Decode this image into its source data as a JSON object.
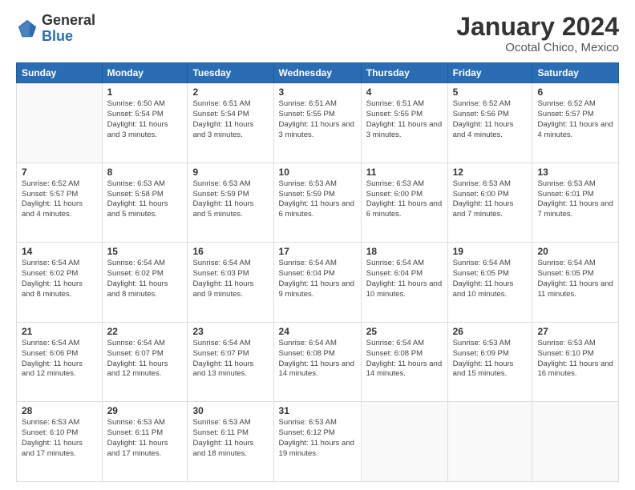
{
  "header": {
    "logo": {
      "general": "General",
      "blue": "Blue"
    },
    "title": "January 2024",
    "subtitle": "Ocotal Chico, Mexico"
  },
  "calendar": {
    "weekdays": [
      "Sunday",
      "Monday",
      "Tuesday",
      "Wednesday",
      "Thursday",
      "Friday",
      "Saturday"
    ],
    "weeks": [
      [
        {
          "day": "",
          "empty": true
        },
        {
          "day": "1",
          "sunrise": "6:50 AM",
          "sunset": "5:54 PM",
          "daylight": "11 hours and 3 minutes."
        },
        {
          "day": "2",
          "sunrise": "6:51 AM",
          "sunset": "5:54 PM",
          "daylight": "11 hours and 3 minutes."
        },
        {
          "day": "3",
          "sunrise": "6:51 AM",
          "sunset": "5:55 PM",
          "daylight": "11 hours and 3 minutes."
        },
        {
          "day": "4",
          "sunrise": "6:51 AM",
          "sunset": "5:55 PM",
          "daylight": "11 hours and 3 minutes."
        },
        {
          "day": "5",
          "sunrise": "6:52 AM",
          "sunset": "5:56 PM",
          "daylight": "11 hours and 4 minutes."
        },
        {
          "day": "6",
          "sunrise": "6:52 AM",
          "sunset": "5:57 PM",
          "daylight": "11 hours and 4 minutes."
        }
      ],
      [
        {
          "day": "7",
          "sunrise": "6:52 AM",
          "sunset": "5:57 PM",
          "daylight": "11 hours and 4 minutes."
        },
        {
          "day": "8",
          "sunrise": "6:53 AM",
          "sunset": "5:58 PM",
          "daylight": "11 hours and 5 minutes."
        },
        {
          "day": "9",
          "sunrise": "6:53 AM",
          "sunset": "5:59 PM",
          "daylight": "11 hours and 5 minutes."
        },
        {
          "day": "10",
          "sunrise": "6:53 AM",
          "sunset": "5:59 PM",
          "daylight": "11 hours and 6 minutes."
        },
        {
          "day": "11",
          "sunrise": "6:53 AM",
          "sunset": "6:00 PM",
          "daylight": "11 hours and 6 minutes."
        },
        {
          "day": "12",
          "sunrise": "6:53 AM",
          "sunset": "6:00 PM",
          "daylight": "11 hours and 7 minutes."
        },
        {
          "day": "13",
          "sunrise": "6:53 AM",
          "sunset": "6:01 PM",
          "daylight": "11 hours and 7 minutes."
        }
      ],
      [
        {
          "day": "14",
          "sunrise": "6:54 AM",
          "sunset": "6:02 PM",
          "daylight": "11 hours and 8 minutes."
        },
        {
          "day": "15",
          "sunrise": "6:54 AM",
          "sunset": "6:02 PM",
          "daylight": "11 hours and 8 minutes."
        },
        {
          "day": "16",
          "sunrise": "6:54 AM",
          "sunset": "6:03 PM",
          "daylight": "11 hours and 9 minutes."
        },
        {
          "day": "17",
          "sunrise": "6:54 AM",
          "sunset": "6:04 PM",
          "daylight": "11 hours and 9 minutes."
        },
        {
          "day": "18",
          "sunrise": "6:54 AM",
          "sunset": "6:04 PM",
          "daylight": "11 hours and 10 minutes."
        },
        {
          "day": "19",
          "sunrise": "6:54 AM",
          "sunset": "6:05 PM",
          "daylight": "11 hours and 10 minutes."
        },
        {
          "day": "20",
          "sunrise": "6:54 AM",
          "sunset": "6:05 PM",
          "daylight": "11 hours and 11 minutes."
        }
      ],
      [
        {
          "day": "21",
          "sunrise": "6:54 AM",
          "sunset": "6:06 PM",
          "daylight": "11 hours and 12 minutes."
        },
        {
          "day": "22",
          "sunrise": "6:54 AM",
          "sunset": "6:07 PM",
          "daylight": "11 hours and 12 minutes."
        },
        {
          "day": "23",
          "sunrise": "6:54 AM",
          "sunset": "6:07 PM",
          "daylight": "11 hours and 13 minutes."
        },
        {
          "day": "24",
          "sunrise": "6:54 AM",
          "sunset": "6:08 PM",
          "daylight": "11 hours and 14 minutes."
        },
        {
          "day": "25",
          "sunrise": "6:54 AM",
          "sunset": "6:08 PM",
          "daylight": "11 hours and 14 minutes."
        },
        {
          "day": "26",
          "sunrise": "6:53 AM",
          "sunset": "6:09 PM",
          "daylight": "11 hours and 15 minutes."
        },
        {
          "day": "27",
          "sunrise": "6:53 AM",
          "sunset": "6:10 PM",
          "daylight": "11 hours and 16 minutes."
        }
      ],
      [
        {
          "day": "28",
          "sunrise": "6:53 AM",
          "sunset": "6:10 PM",
          "daylight": "11 hours and 17 minutes."
        },
        {
          "day": "29",
          "sunrise": "6:53 AM",
          "sunset": "6:11 PM",
          "daylight": "11 hours and 17 minutes."
        },
        {
          "day": "30",
          "sunrise": "6:53 AM",
          "sunset": "6:11 PM",
          "daylight": "11 hours and 18 minutes."
        },
        {
          "day": "31",
          "sunrise": "6:53 AM",
          "sunset": "6:12 PM",
          "daylight": "11 hours and 19 minutes."
        },
        {
          "day": "",
          "empty": true
        },
        {
          "day": "",
          "empty": true
        },
        {
          "day": "",
          "empty": true
        }
      ]
    ]
  }
}
